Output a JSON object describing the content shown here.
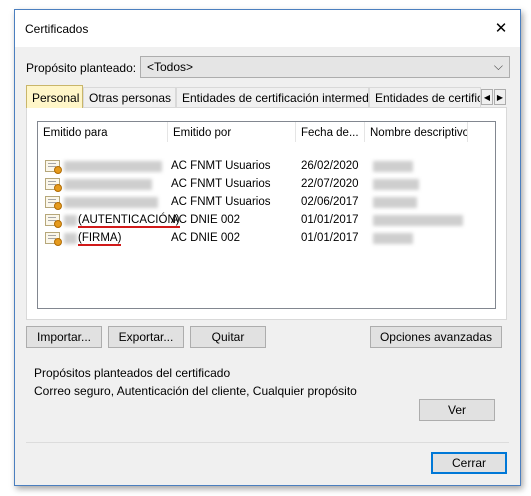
{
  "window": {
    "title": "Certificados",
    "close_glyph": "✕"
  },
  "purpose": {
    "label": "Propósito planteado:",
    "value": "<Todos>"
  },
  "tabs": [
    {
      "label": "Personal"
    },
    {
      "label": "Otras personas"
    },
    {
      "label": "Entidades de certificación intermedias"
    },
    {
      "label": "Entidades de certificación"
    }
  ],
  "tab_scroll": {
    "left": "◀",
    "right": "▶"
  },
  "list": {
    "columns": [
      "Emitido para",
      "Emitido por",
      "Fecha de...",
      "Nombre descriptivo"
    ],
    "rows": [
      {
        "issued_to": "",
        "issued_by": "AC FNMT Usuarios",
        "expires": "26/02/2020",
        "friendly": ""
      },
      {
        "issued_to": "",
        "issued_by": "AC FNMT Usuarios",
        "expires": "22/07/2020",
        "friendly": ""
      },
      {
        "issued_to": "",
        "issued_by": "AC FNMT Usuarios",
        "expires": "02/06/2017",
        "friendly": ""
      },
      {
        "issued_to": "(AUTENTICACIÓN)",
        "issued_by": "AC DNIE 002",
        "expires": "01/01/2017",
        "friendly": ""
      },
      {
        "issued_to": "(FIRMA)",
        "issued_by": "AC DNIE 002",
        "expires": "01/01/2017",
        "friendly": ""
      }
    ]
  },
  "buttons": {
    "import": "Importar...",
    "export": "Exportar...",
    "remove": "Quitar",
    "advanced": "Opciones avanzadas",
    "view": "Ver",
    "close": "Cerrar"
  },
  "purposes_group": {
    "label": "Propósitos planteados del certificado",
    "text": "Correo seguro, Autenticación del cliente, Cualquier propósito"
  },
  "colors": {
    "active_tab": "#fff6c8",
    "highlight_underline": "#d11a1a",
    "default_button_border": "#0078d7"
  }
}
